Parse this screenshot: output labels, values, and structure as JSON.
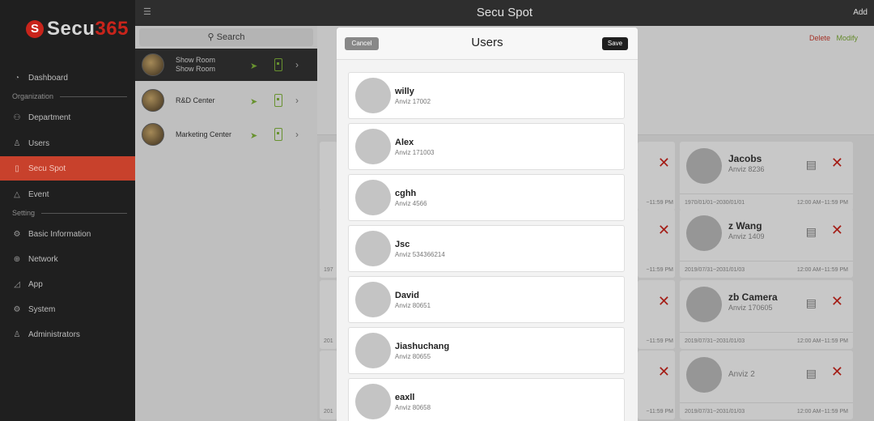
{
  "app": {
    "logo_mark": "S",
    "logo_text": "Secu",
    "logo_accent": "365",
    "title": "Secu Spot",
    "add_label": "Add",
    "menu_icon": "hamburger-icon"
  },
  "sidebar": {
    "items": [
      {
        "label": "Dashboard",
        "icon": "dashboard-icon",
        "active": false
      },
      {
        "label": "Department",
        "icon": "department-icon",
        "active": false
      },
      {
        "label": "Users",
        "icon": "user-icon",
        "active": false
      },
      {
        "label": "Secu Spot",
        "icon": "door-icon",
        "active": true
      },
      {
        "label": "Event",
        "icon": "warning-icon",
        "active": false
      },
      {
        "label": "Basic Information",
        "icon": "gear-icon",
        "active": false
      },
      {
        "label": "Network",
        "icon": "globe-icon",
        "active": false
      },
      {
        "label": "App",
        "icon": "app-icon",
        "active": false
      },
      {
        "label": "System",
        "icon": "gear-icon",
        "active": false
      },
      {
        "label": "Administrators",
        "icon": "admin-icon",
        "active": false
      }
    ],
    "sections": [
      "Organization",
      "Setting"
    ]
  },
  "search": {
    "label": "Search",
    "icon": "search-icon"
  },
  "spots": [
    {
      "name": "Show Room",
      "sub": "Show Room",
      "selected": true
    },
    {
      "name": "R&D Center",
      "sub": "",
      "selected": false
    },
    {
      "name": "Marketing Center",
      "sub": "",
      "selected": false
    }
  ],
  "detail": {
    "delete_label": "Delete",
    "modify_label": "Modify"
  },
  "cards": [
    {
      "name": "Jacobs",
      "id": "Anviz  8236",
      "date": "1970/01/01~2030/01/01",
      "time": "12:00 AM~11:59 PM"
    },
    {
      "name": "z Wang",
      "id": "Anviz  1409",
      "date": "2019/07/31~2031/01/03",
      "time": "12:00 AM~11:59 PM"
    },
    {
      "name": "zb Camera",
      "id": "Anviz  170605",
      "date": "2019/07/31~2031/01/03",
      "time": "12:00 AM~11:59 PM"
    },
    {
      "name": "",
      "id": "Anviz  2",
      "date": "2019/07/31~2031/01/03",
      "time": "12:00 AM~11:59 PM"
    }
  ],
  "partial_cards": {
    "time": "~11:59 PM",
    "dates": [
      "197",
      "201",
      "201"
    ]
  },
  "modal": {
    "title": "Users",
    "cancel_label": "Cancel",
    "save_label": "Save",
    "users": [
      {
        "name": "willy",
        "sub": "Anviz  17002"
      },
      {
        "name": "Alex",
        "sub": "Anviz  171003"
      },
      {
        "name": "cghh",
        "sub": "Anviz  4566"
      },
      {
        "name": "Jsc",
        "sub": "Anviz  534366214"
      },
      {
        "name": "David",
        "sub": "Anviz  80651"
      },
      {
        "name": "Jiashuchang",
        "sub": "Anviz  80655"
      },
      {
        "name": "eaxll",
        "sub": "Anviz  80658"
      }
    ]
  },
  "colors": {
    "brand": "#c8241b",
    "active_nav": "#c8412c",
    "accent_green": "#7fb23a"
  }
}
